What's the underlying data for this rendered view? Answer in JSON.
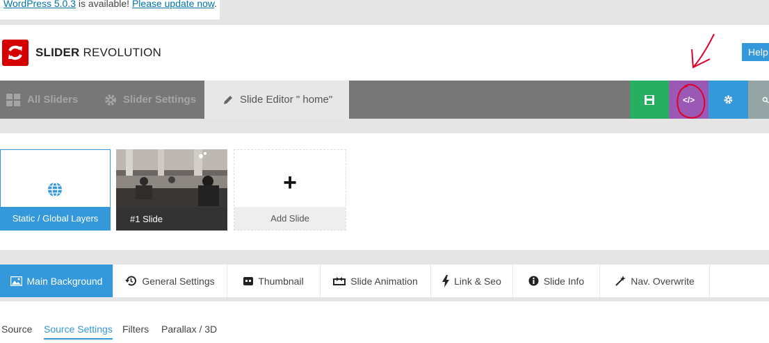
{
  "notice": {
    "version_link": "WordPress 5.0.3",
    "middle_text": " is available! ",
    "update_link": "Please update now",
    "end": "."
  },
  "header": {
    "brand_bold": "SLIDER",
    "brand_rest": " REVOLUTION",
    "help_label": "Help"
  },
  "nav": {
    "all_sliders": "All Sliders",
    "slider_settings": "Slider Settings",
    "slide_editor": "Slide Editor \" home\"",
    "code_label": "</>"
  },
  "slides": {
    "static_label": "Static / Global Layers",
    "slide1_label": "#1 Slide",
    "add_plus": "+",
    "add_label": "Add Slide"
  },
  "tabs": [
    {
      "label": "Main Background"
    },
    {
      "label": "General Settings"
    },
    {
      "label": "Thumbnail"
    },
    {
      "label": "Slide Animation"
    },
    {
      "label": "Link & Seo"
    },
    {
      "label": "Slide Info"
    },
    {
      "label": "Nav. Overwrite"
    }
  ],
  "subtabs": [
    {
      "label": "Source"
    },
    {
      "label": "Source Settings"
    },
    {
      "label": "Filters"
    },
    {
      "label": "Parallax / 3D"
    }
  ],
  "colors": {
    "accent_blue": "#3498db",
    "save_green": "#27ae60",
    "code_purple": "#9b59b6",
    "logo_red": "#d50000",
    "annotation_red": "#e0002a"
  }
}
